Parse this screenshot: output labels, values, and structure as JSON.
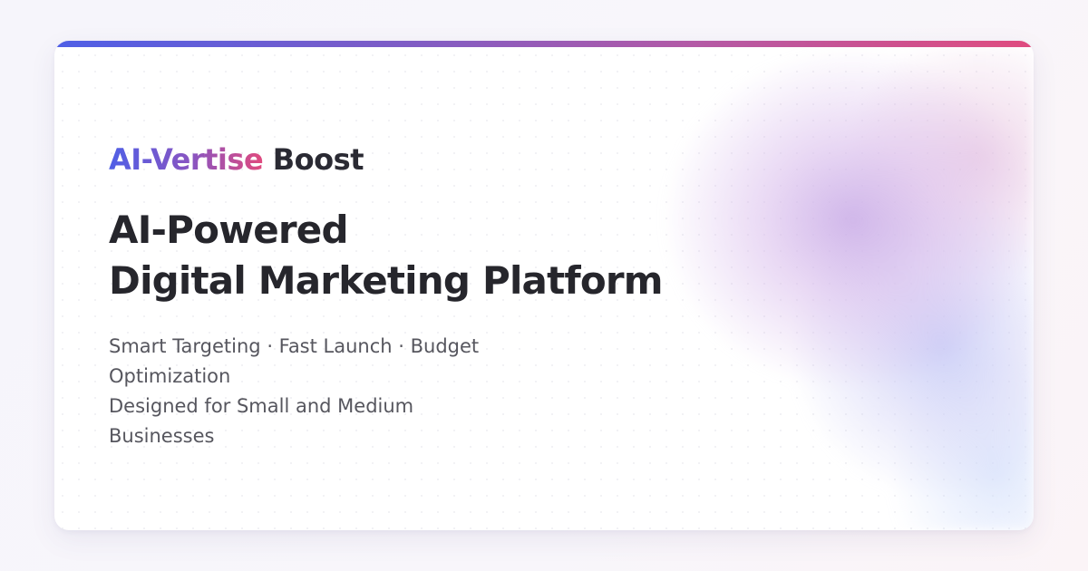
{
  "brand": {
    "accent": "AI-Vertise",
    "rest": "Boost"
  },
  "headline": {
    "line1": "AI-Powered",
    "line2": "Digital Marketing Platform"
  },
  "subtitle": {
    "features_line1": "Smart Targeting · Fast Launch · Budget",
    "features_line2": "Optimization",
    "audience": "Designed for Small and Medium Businesses"
  },
  "colors": {
    "gradient_start": "#4f5fe6",
    "gradient_mid": "#8b55c0",
    "gradient_end": "#e04a7e",
    "text_dark": "#26262c",
    "text_muted": "#56565e"
  }
}
